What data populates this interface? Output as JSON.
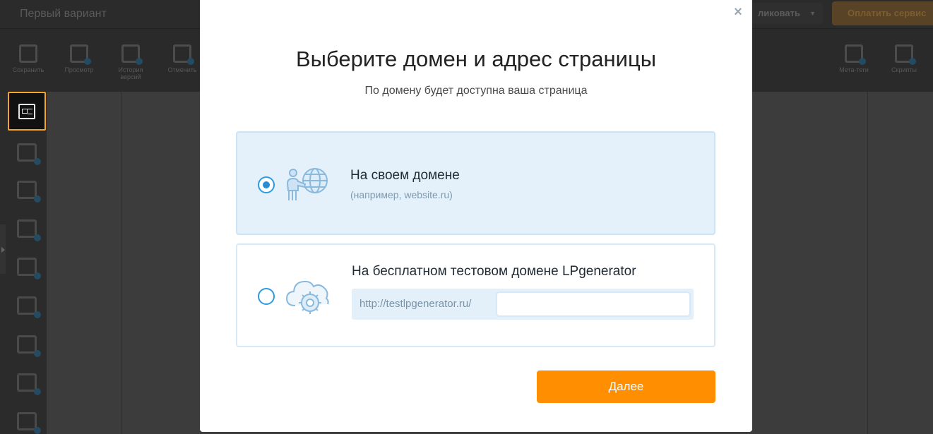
{
  "app": {
    "variant_name": "Первый вариант",
    "publish_label": "ликовать",
    "pay_label": "Оплатить сервис",
    "toolbar": [
      {
        "id": "save",
        "label": "Сохранить"
      },
      {
        "id": "preview",
        "label": "Просмотр"
      },
      {
        "id": "history",
        "label": "История версий"
      },
      {
        "id": "undo",
        "label": "Отменить"
      },
      {
        "id": "meta",
        "label": "Мета-теги"
      },
      {
        "id": "scripts",
        "label": "Скрипты"
      }
    ]
  },
  "modal": {
    "close_symbol": "×",
    "title": "Выберите домен и адрес страницы",
    "subtitle": "По домену будет доступна ваша страница",
    "options": [
      {
        "title": "На своем домене",
        "hint": "(например, website.ru)",
        "selected": true
      },
      {
        "title": "На бесплатном тестовом домене LPgenerator",
        "prefix": "http://testlpgenerator.ru/",
        "input_value": "",
        "selected": false
      }
    ],
    "next_label": "Далее"
  },
  "colors": {
    "accent": "#ff8f00",
    "radio": "#2e9be0",
    "selected_bg": "#e4f1fb",
    "icon_stroke": "#8ab9de",
    "icon_fill": "#cde3f5"
  }
}
